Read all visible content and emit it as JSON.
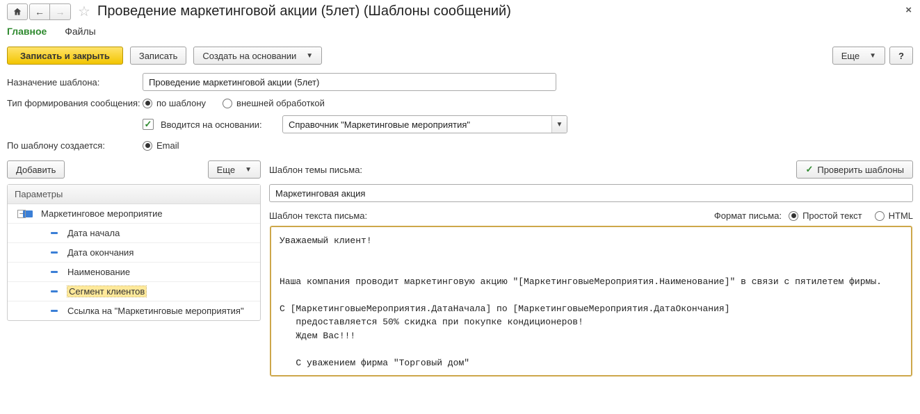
{
  "title": "Проведение маркетинговой акции (5лет) (Шаблоны сообщений)",
  "tabs": {
    "main": "Главное",
    "files": "Файлы"
  },
  "toolbar": {
    "write_close": "Записать и закрыть",
    "write": "Записать",
    "create_based": "Создать на основании",
    "more": "Еще",
    "help": "?"
  },
  "form": {
    "purpose_label": "Назначение шаблона:",
    "purpose_value": "Проведение маркетинговой акции (5лет)",
    "type_label": "Тип формирования сообщения:",
    "type_opt1": "по шаблону",
    "type_opt2": "внешней обработкой",
    "based_on_checkbox": "Вводится на основании:",
    "based_on_value": "Справочник \"Маркетинговые мероприятия\"",
    "creates_label": "По шаблону создается:",
    "creates_opt1": "Email"
  },
  "left": {
    "add": "Добавить",
    "more": "Еще",
    "header": "Параметры",
    "root": "Маркетинговое мероприятие",
    "items": [
      "Дата начала",
      "Дата окончания",
      "Наименование",
      "Сегмент клиентов",
      "Ссылка на \"Маркетинговые мероприятия\""
    ]
  },
  "right": {
    "subject_label": "Шаблон темы письма:",
    "check_btn": "Проверить шаблоны",
    "subject_value": "Маркетинговая акция",
    "body_label": "Шаблон текста письма:",
    "format_label": "Формат письма:",
    "format_opt1": "Простой текст",
    "format_opt2": "HTML",
    "body_text": "Уважаемый клиент!\n\n\nНаша компания проводит маркетинговую акцию \"[МаркетинговыеМероприятия.Наименование]\" в связи с пятилетем фирмы.\n\nС [МаркетинговыеМероприятия.ДатаНачала] по [МаркетинговыеМероприятия.ДатаОкончания]\n   предоставляется 50% скидка при покупке кондиционеров!\n   Ждем Вас!!!\n\n   С уважением фирма \"Торговый дом\""
  }
}
